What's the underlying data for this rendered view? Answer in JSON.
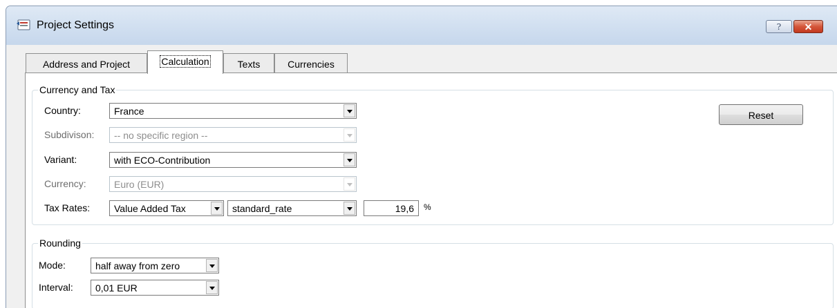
{
  "window": {
    "title": "Project Settings",
    "help_glyph": "?",
    "close_glyph": "✕",
    "icon": "project-settings-icon"
  },
  "tabs": [
    {
      "label": "Address and Project"
    },
    {
      "label": "Calculation"
    },
    {
      "label": "Texts"
    },
    {
      "label": "Currencies"
    }
  ],
  "active_tab": "Calculation",
  "currency_tax": {
    "title": "Currency and Tax",
    "country": {
      "label": "Country:",
      "value": "France"
    },
    "subdivision": {
      "label": "Subdivison:",
      "value": "-- no specific region --",
      "disabled": true
    },
    "variant": {
      "label": "Variant:",
      "value": "with ECO-Contribution"
    },
    "currency": {
      "label": "Currency:",
      "value": "Euro (EUR)",
      "disabled": true
    },
    "tax_rates": {
      "label": "Tax Rates:",
      "type": "Value Added Tax",
      "rate": "standard_rate",
      "percent": "19,6",
      "unit": "%"
    },
    "reset_label": "Reset"
  },
  "rounding": {
    "title": "Rounding",
    "mode": {
      "label": "Mode:",
      "value": "half away from zero"
    },
    "interval": {
      "label": "Interval:",
      "value": "0,01 EUR"
    }
  }
}
